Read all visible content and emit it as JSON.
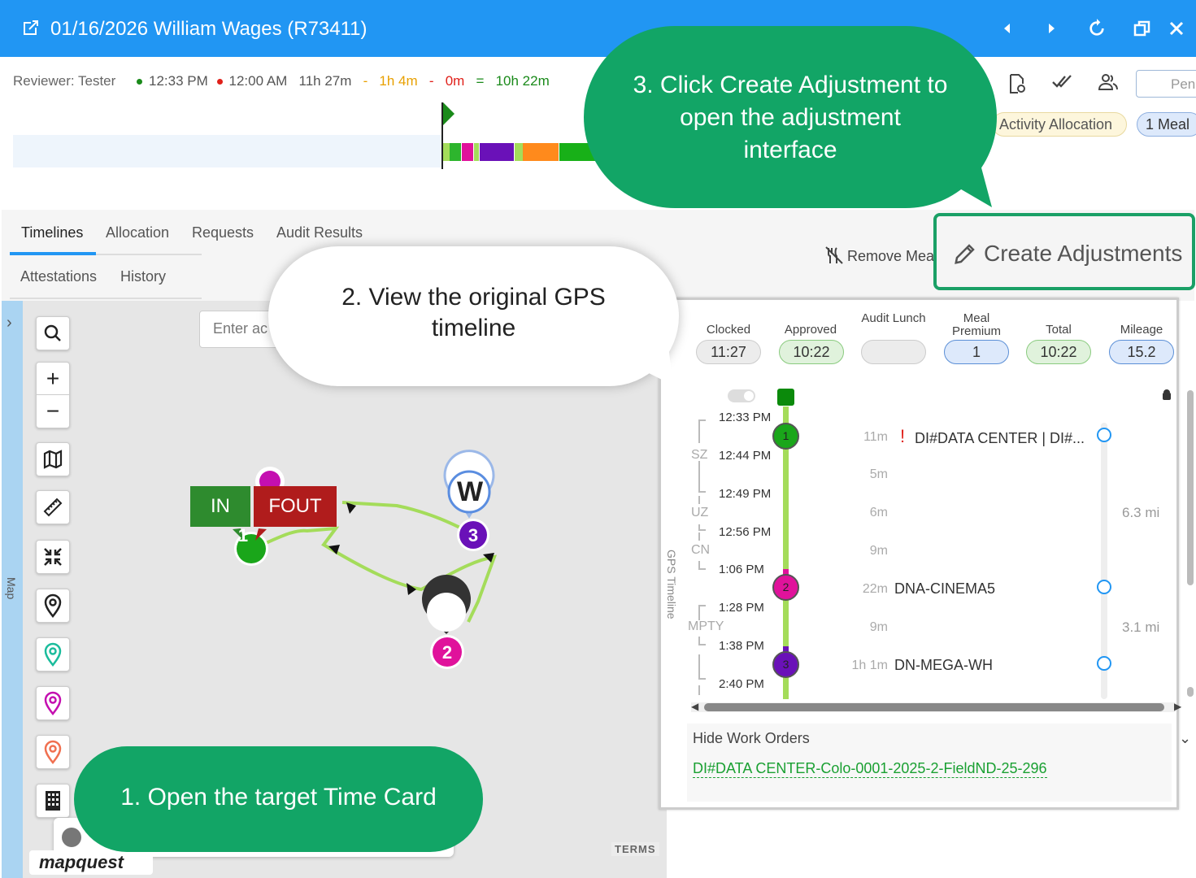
{
  "window": {
    "title": "01/16/2026 William Wages (R73411)"
  },
  "header": {
    "reviewer": "Reviewer: Tester",
    "clock_in": "12:33 PM",
    "clock_out": "12:00 AM",
    "duration": "11h 27m",
    "sep1": "-",
    "deduction": "1h 4m",
    "sep2": "-",
    "zero": "0m",
    "equals": "=",
    "net": "10h 22m",
    "pending_placeholder": "Pen",
    "pill_activity": "Activity Allocation",
    "pill_meal": "1 Meal"
  },
  "tabs": {
    "row1": [
      "Timelines",
      "Allocation",
      "Requests",
      "Audit Results"
    ],
    "row2": [
      "Attestations",
      "History"
    ],
    "remove_meal": "Remove Mea",
    "create_adjustments": "Create Adjustments"
  },
  "map": {
    "search_placeholder": "Enter ac",
    "side_label": "Map",
    "flag_in": "IN",
    "flag_fout": "FOUT",
    "marker_w": "W",
    "marker_1": "1",
    "marker_2": "2",
    "marker_3": "3",
    "terms": "TERMS",
    "logo": "mapquest"
  },
  "gps": {
    "vertical_label": "GPS Timeline",
    "stats": [
      {
        "label": "Clocked",
        "value": "11:27"
      },
      {
        "label": "Approved",
        "value": "10:22"
      },
      {
        "label": "Audit Lunch",
        "value": ""
      },
      {
        "label": "Meal Premium",
        "value": "1"
      },
      {
        "label": "Total",
        "value": "10:22"
      },
      {
        "label": "Mileage",
        "value": "15.2"
      }
    ],
    "times": [
      "12:33 PM",
      "12:44 PM",
      "12:49 PM",
      "12:56 PM",
      "1:06 PM",
      "1:28 PM",
      "1:38 PM",
      "2:40 PM"
    ],
    "zones": [
      "SZ",
      "UZ",
      "CN",
      "MPTY"
    ],
    "durations": [
      "11m",
      "5m",
      "6m",
      "9m",
      "22m",
      "9m",
      "1h 1m"
    ],
    "stops": [
      {
        "num": "1",
        "alert": "!",
        "location": "DI#DATA CENTER | DI#..."
      },
      {
        "num": "2",
        "location": "DNA-CINEMA5"
      },
      {
        "num": "3",
        "location": "DN-MEGA-WH"
      }
    ],
    "miles": [
      "6.3 mi",
      "3.1 mi"
    ],
    "hide_work_orders": "Hide Work Orders",
    "work_order_link": "DI#DATA CENTER-Colo-0001-2025-2-FieldND-25-296"
  },
  "callouts": {
    "step1": "1. Open the target Time Card",
    "step2_line1": "2. View the original GPS",
    "step2_line2": "timeline",
    "step3_line1": "3. Click Create Adjustment to",
    "step3_line2": "open the adjustment",
    "step3_line3": "interface"
  },
  "colors": {
    "titlebar": "#2196f3",
    "callout_green": "#12a566",
    "stop1": "#1aa61a",
    "stop2": "#e0129b",
    "stop3": "#6a11b8",
    "path": "#a4dc5a"
  }
}
